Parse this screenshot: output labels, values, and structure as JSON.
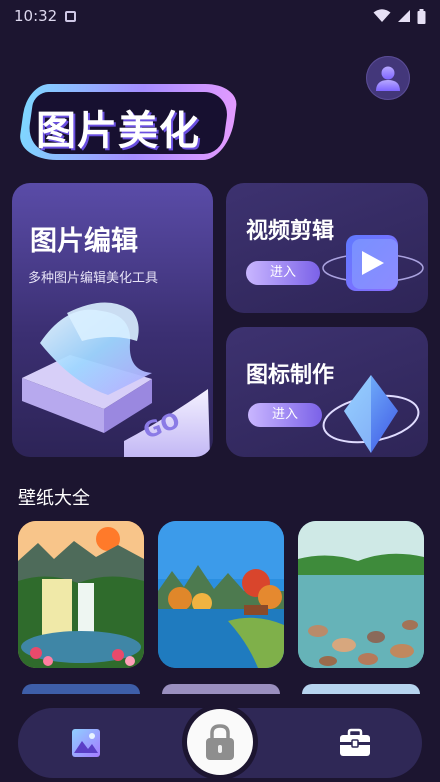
{
  "status_bar": {
    "time": "10:32"
  },
  "logo": {
    "text": "图片美化"
  },
  "cards": {
    "edit": {
      "title": "图片编辑",
      "subtitle": "多种图片编辑美化工具",
      "go_text": "GO"
    },
    "video": {
      "title": "视频剪辑",
      "button": "进入"
    },
    "icon": {
      "title": "图标制作",
      "button": "进入"
    }
  },
  "wallpaper": {
    "section_title": "壁纸大全"
  },
  "colors": {
    "background": "#1c1530",
    "card": "#2e2557",
    "accent": "#7b62e8",
    "nav": "#2f2856"
  },
  "nav": {
    "items": [
      "gallery-icon",
      "lock-icon",
      "toolbox-icon"
    ]
  }
}
